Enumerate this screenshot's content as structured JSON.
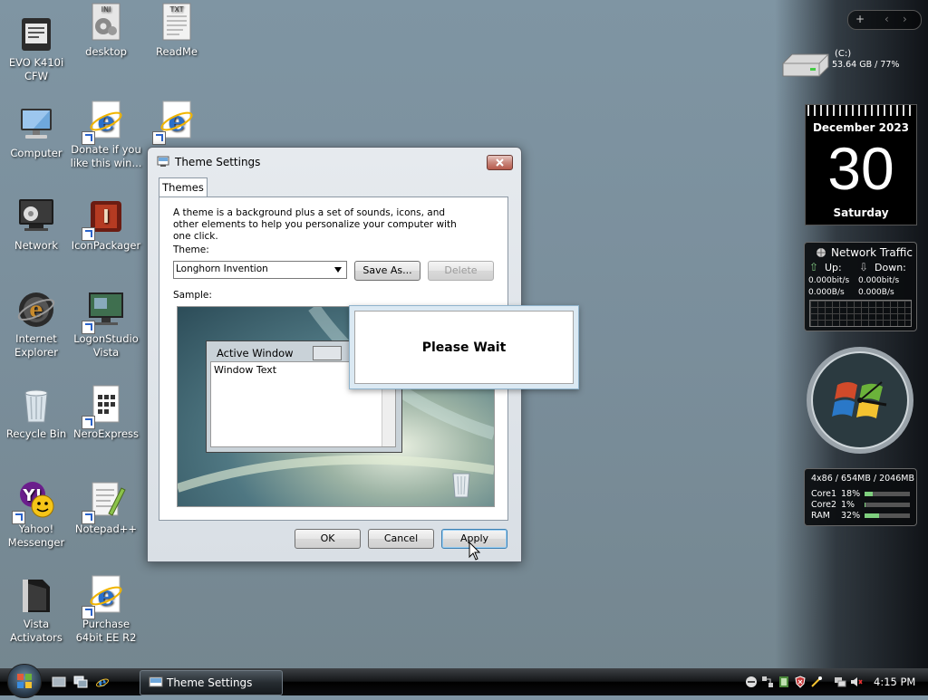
{
  "desktop": {
    "icons": [
      {
        "label": "EVO K410i CFW"
      },
      {
        "label": "desktop"
      },
      {
        "label": "ReadMe"
      },
      {
        "label": "Computer"
      },
      {
        "label": "Donate if you like this win..."
      },
      {
        "label": "Network"
      },
      {
        "label": "IconPackager"
      },
      {
        "label": "Internet Explorer"
      },
      {
        "label": "LogonStudio Vista"
      },
      {
        "label": "Recycle Bin"
      },
      {
        "label": "NeroExpress"
      },
      {
        "label": "Yahoo! Messenger"
      },
      {
        "label": "Notepad++"
      },
      {
        "label": "Vista Activators"
      },
      {
        "label": "Purchase 64bit EE R2"
      }
    ],
    "file_badges": {
      "ini": "INI",
      "txt": "TXT"
    }
  },
  "sidebar": {
    "controls": {
      "add": "+",
      "prev": "‹",
      "next": "›"
    },
    "drive": {
      "name": "(C:)",
      "usage": "53.64 GB / 77%"
    },
    "calendar": {
      "month_year": "December 2023",
      "day": "30",
      "weekday": "Saturday"
    },
    "network": {
      "title": "Network Traffic",
      "up_label": "Up:",
      "down_label": "Down:",
      "up_bits": "0.000bit/s",
      "down_bits": "0.000bit/s",
      "up_bytes": "0.000B/s",
      "down_bytes": "0.000B/s"
    },
    "cpu": {
      "summary": "4x86 / 654MB / 2046MB",
      "rows": [
        {
          "label": "Core1",
          "value": "18%",
          "fill": 0.18
        },
        {
          "label": "Core2",
          "value": "1%",
          "fill": 0.01
        },
        {
          "label": "RAM",
          "value": "32%",
          "fill": 0.32
        }
      ]
    }
  },
  "window": {
    "title": "Theme Settings",
    "tab": "Themes",
    "description": "A theme is a background plus a set of sounds, icons, and other elements to help you personalize your computer with one click.",
    "theme_label": "Theme:",
    "theme_value": "Longhorn Invention",
    "save_as": "Save As...",
    "delete": "Delete",
    "sample_label": "Sample:",
    "sample": {
      "active_window": "Active Window",
      "window_text": "Window Text"
    },
    "ok": "OK",
    "cancel": "Cancel",
    "apply": "Apply"
  },
  "dialog": {
    "message": "Please Wait"
  },
  "taskbar": {
    "task": "Theme Settings",
    "clock": "4:15 PM"
  },
  "colors": {
    "accent": "#2a62c9",
    "taskbar": "#141618",
    "desktop": "#7a8e9b"
  }
}
